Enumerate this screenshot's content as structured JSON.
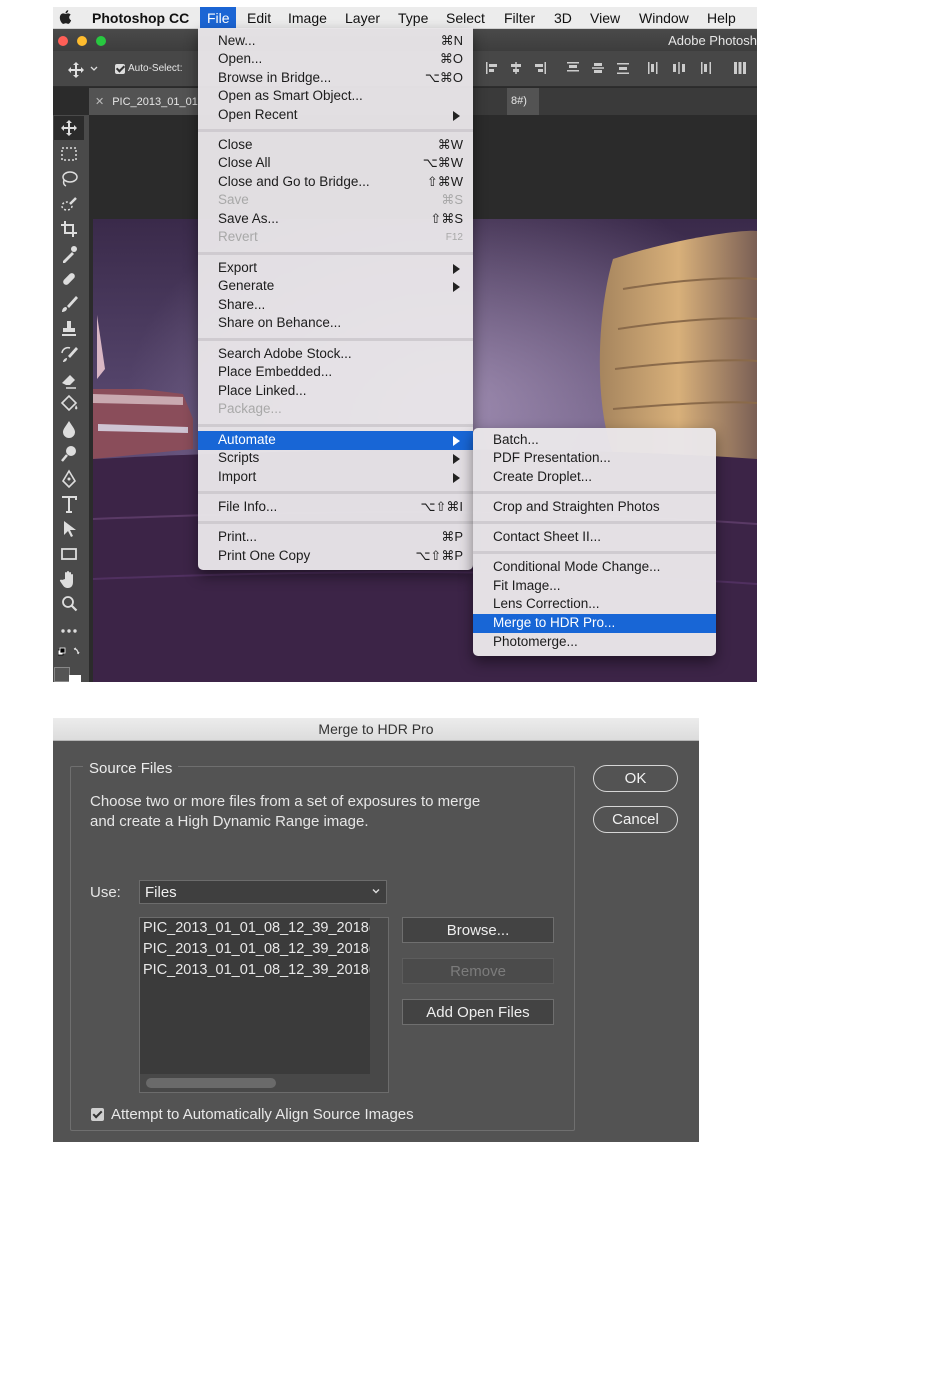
{
  "menubar": {
    "app_name": "Photoshop CC",
    "items": [
      "File",
      "Edit",
      "Image",
      "Layer",
      "Type",
      "Select",
      "Filter",
      "3D",
      "View",
      "Window",
      "Help"
    ]
  },
  "window": {
    "title": "Adobe Photosh"
  },
  "options_bar": {
    "auto_select_label": "Auto-Select:"
  },
  "document_tab": {
    "name": "PIC_2013_01_01",
    "suffix": "8#)"
  },
  "file_menu": {
    "items": [
      {
        "label": "New...",
        "shortcut": "⌘N"
      },
      {
        "label": "Open...",
        "shortcut": "⌘O"
      },
      {
        "label": "Browse in Bridge...",
        "shortcut": "⌥⌘O"
      },
      {
        "label": "Open as Smart Object...",
        "shortcut": ""
      },
      {
        "label": "Open Recent",
        "shortcut": ""
      },
      {
        "label": "Close",
        "shortcut": "⌘W"
      },
      {
        "label": "Close All",
        "shortcut": "⌥⌘W"
      },
      {
        "label": "Close and Go to Bridge...",
        "shortcut": "⇧⌘W"
      },
      {
        "label": "Save",
        "shortcut": "⌘S"
      },
      {
        "label": "Save As...",
        "shortcut": "⇧⌘S"
      },
      {
        "label": "Revert",
        "shortcut": "F12"
      },
      {
        "label": "Export",
        "shortcut": ""
      },
      {
        "label": "Generate",
        "shortcut": ""
      },
      {
        "label": "Share...",
        "shortcut": ""
      },
      {
        "label": "Share on Behance...",
        "shortcut": ""
      },
      {
        "label": "Search Adobe Stock...",
        "shortcut": ""
      },
      {
        "label": "Place Embedded...",
        "shortcut": ""
      },
      {
        "label": "Place Linked...",
        "shortcut": ""
      },
      {
        "label": "Package...",
        "shortcut": ""
      },
      {
        "label": "Automate",
        "shortcut": ""
      },
      {
        "label": "Scripts",
        "shortcut": ""
      },
      {
        "label": "Import",
        "shortcut": ""
      },
      {
        "label": "File Info...",
        "shortcut": "⌥⇧⌘I"
      },
      {
        "label": "Print...",
        "shortcut": "⌘P"
      },
      {
        "label": "Print One Copy",
        "shortcut": "⌥⇧⌘P"
      }
    ]
  },
  "automate_menu": {
    "items": [
      {
        "label": "Batch..."
      },
      {
        "label": "PDF Presentation..."
      },
      {
        "label": "Create Droplet..."
      },
      {
        "label": "Crop and Straighten Photos"
      },
      {
        "label": "Contact Sheet II..."
      },
      {
        "label": "Conditional Mode Change..."
      },
      {
        "label": "Fit Image..."
      },
      {
        "label": "Lens Correction..."
      },
      {
        "label": "Merge to HDR Pro..."
      },
      {
        "label": "Photomerge..."
      }
    ]
  },
  "dialog": {
    "title": "Merge to HDR Pro",
    "group_title": "Source Files",
    "description": "Choose two or more files from a set of exposures to merge and create a High Dynamic Range image.",
    "use_label": "Use:",
    "use_value": "Files",
    "files": [
      "PIC_2013_01_01_08_12_39_2018(",
      "PIC_2013_01_01_08_12_39_2018(",
      "PIC_2013_01_01_08_12_39_2018("
    ],
    "browse_label": "Browse...",
    "remove_label": "Remove",
    "add_open_label": "Add Open Files",
    "ok_label": "OK",
    "cancel_label": "Cancel",
    "align_label": "Attempt to Automatically Align Source Images",
    "align_checked": true
  },
  "colors": {
    "menu_highlight": "#1866d6",
    "dialog_bg": "#535353",
    "photo_sky": "#3a2a4a",
    "photo_hull": "#c8a070"
  }
}
